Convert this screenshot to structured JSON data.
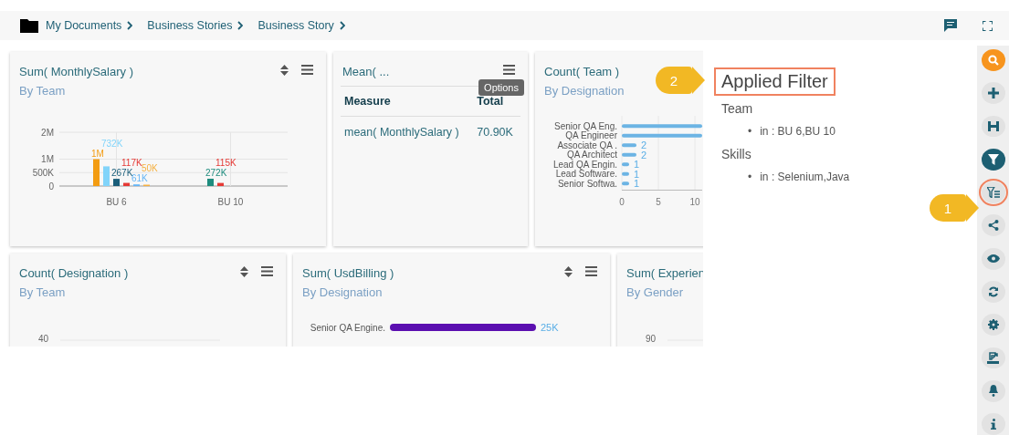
{
  "breadcrumb": {
    "items": [
      "My Documents",
      "Business Stories",
      "Business Story"
    ]
  },
  "dashboard": {
    "rows": [
      {
        "cards": [
          {
            "kind": "chart",
            "title": "Sum( MonthlySalary )",
            "subtitle": "By Team",
            "sortable": true,
            "chart_data": {
              "type": "bar",
              "grid": true,
              "categories": [
                "BU 6",
                "BU 10"
              ],
              "ylim": [
                0,
                2000000
              ],
              "yticks": [
                {
                  "value": 0,
                  "label": "0"
                },
                {
                  "value": 500000,
                  "label": "500K"
                },
                {
                  "value": 1000000,
                  "label": "1M"
                },
                {
                  "value": 2000000,
                  "label": "2M"
                }
              ],
              "series": [
                {
                  "color": "#f39c12",
                  "values": [
                    1000000,
                    null
                  ],
                  "value_labels": [
                    "1M",
                    null
                  ]
                },
                {
                  "color": "#81d4fa",
                  "values": [
                    732000,
                    null
                  ],
                  "value_labels": [
                    "732K",
                    null
                  ]
                },
                {
                  "color": "#1b5e7a",
                  "values": [
                    267000,
                    null
                  ],
                  "value_labels": [
                    "267K",
                    null
                  ]
                },
                {
                  "color": "#1e8c7e",
                  "values": [
                    null,
                    272000
                  ],
                  "value_labels": [
                    null,
                    "272K"
                  ]
                },
                {
                  "color": "#e53935",
                  "values": [
                    117000,
                    115000
                  ],
                  "value_labels": [
                    "117K",
                    "115K"
                  ]
                },
                {
                  "color": "#64b5f6",
                  "values": [
                    61000,
                    null
                  ],
                  "value_labels": [
                    "61K",
                    null
                  ]
                },
                {
                  "color": "#f5b041",
                  "values": [
                    50000,
                    null
                  ],
                  "value_labels": [
                    "50K",
                    null
                  ]
                }
              ]
            }
          },
          {
            "kind": "table",
            "title": "Mean( ...",
            "sortable": false,
            "tooltip": "Options",
            "columns": [
              "Measure",
              "Total"
            ],
            "rows": [
              [
                "mean( MonthlySalary )",
                "70.90K"
              ]
            ]
          },
          {
            "kind": "chart",
            "title": "Count( Team )",
            "subtitle": "By Designation",
            "sortable": false,
            "chart_data": {
              "type": "bar",
              "orientation": "horizontal",
              "grid": true,
              "categories": [
                "Senior QA Eng.",
                "QA Engineer",
                "Associate QA .",
                "QA Architect",
                "Lead QA Engin.",
                "Lead Software.",
                "Senior Softwa."
              ],
              "xlim": [
                0,
                11
              ],
              "xticks": [
                0,
                5,
                10
              ],
              "series": [
                {
                  "color": "#6cb4e4",
                  "values": [
                    11,
                    11,
                    2,
                    2,
                    1,
                    1,
                    1
                  ],
                  "value_labels": [
                    null,
                    null,
                    "2",
                    "2",
                    "1",
                    "1",
                    "1"
                  ]
                }
              ]
            }
          }
        ]
      },
      {
        "cards": [
          {
            "kind": "axis",
            "title": "Count( Designation )",
            "subtitle": "By Team",
            "sortable": true,
            "tick": "40"
          },
          {
            "kind": "chart",
            "title": "Sum( UsdBilling )",
            "subtitle": "By Designation",
            "sortable": true,
            "chart_data": {
              "type": "bar",
              "orientation": "horizontal",
              "categories": [
                "Senior QA Engine."
              ],
              "series": [
                {
                  "color": "#5b0fb0",
                  "values": [
                    25000
                  ],
                  "value_labels": [
                    "25K"
                  ]
                }
              ]
            }
          },
          {
            "kind": "axis",
            "title": "Sum( Experien",
            "subtitle": "By Gender",
            "sortable": false,
            "tick": "90"
          }
        ]
      }
    ]
  },
  "filter_panel": {
    "title": "Applied Filter",
    "highlighted": true,
    "callout": "2",
    "groups": [
      {
        "name": "Team",
        "values": [
          {
            "bullet": "•",
            "text": "in : BU 6,BU 10"
          }
        ]
      },
      {
        "name": "Skills",
        "values": [
          {
            "bullet": "•",
            "text": "in : Selenium,Java"
          }
        ]
      }
    ]
  },
  "rail": {
    "items": [
      {
        "kind": "search",
        "selected": false,
        "highlighted": false
      },
      {
        "kind": "add",
        "selected": false,
        "highlighted": false
      },
      {
        "kind": "save",
        "selected": false,
        "highlighted": false
      },
      {
        "kind": "filter",
        "selected": true,
        "highlighted": false
      },
      {
        "kind": "filter-list",
        "selected": false,
        "highlighted": true,
        "callout": "1"
      },
      {
        "kind": "share",
        "selected": false,
        "highlighted": false
      },
      {
        "kind": "view",
        "selected": false,
        "highlighted": false
      },
      {
        "kind": "refresh",
        "selected": false,
        "highlighted": false
      },
      {
        "kind": "settings",
        "selected": false,
        "highlighted": false
      },
      {
        "kind": "export",
        "selected": false,
        "highlighted": false
      },
      {
        "kind": "bell",
        "selected": false,
        "highlighted": false
      },
      {
        "kind": "info",
        "selected": false,
        "highlighted": false
      }
    ]
  }
}
